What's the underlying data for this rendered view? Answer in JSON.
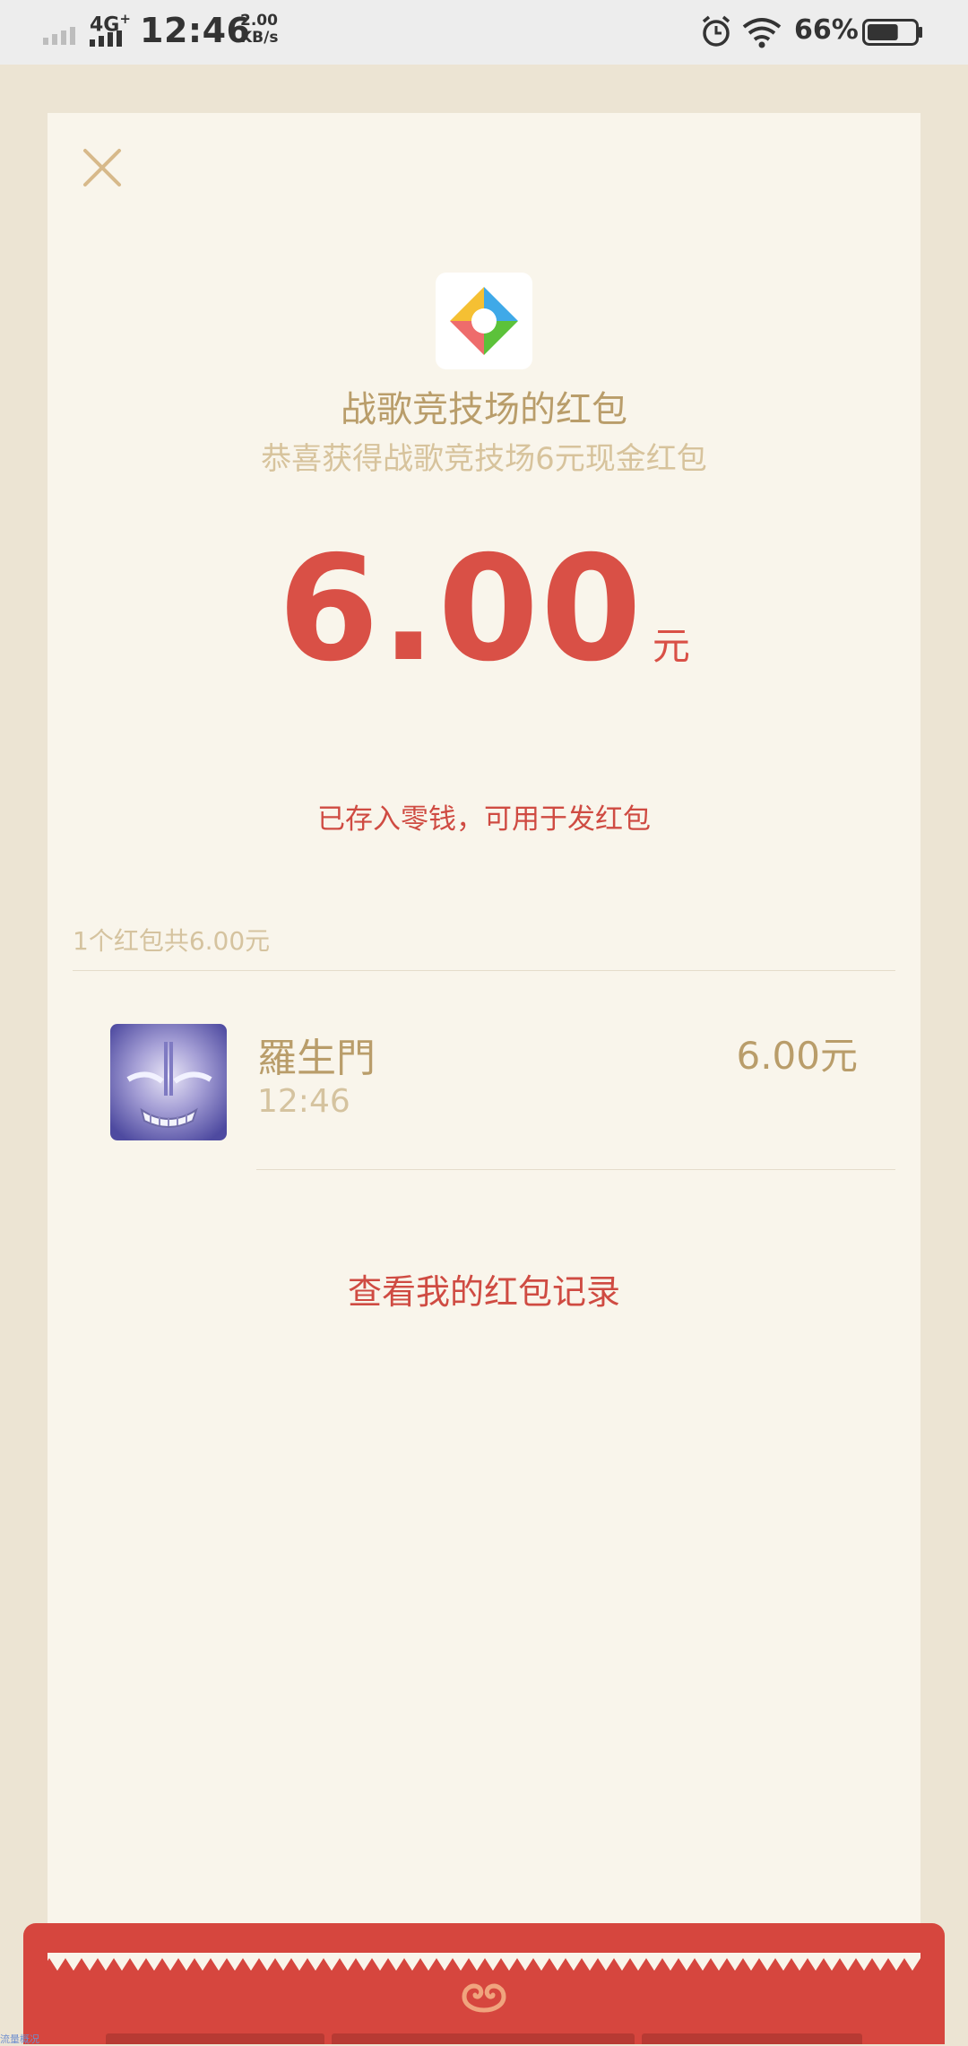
{
  "status_bar": {
    "network": "4G",
    "network_plus": "+",
    "time": "12:46",
    "speed_value": "2.00",
    "speed_unit": "KB/s",
    "battery_pct": "66%",
    "battery_level": 0.66,
    "icons": [
      "signal-icon",
      "alarm-icon",
      "wifi-icon",
      "battery-icon"
    ]
  },
  "card": {
    "close_icon": "close-icon",
    "app_logo": "game-arena-logo-icon",
    "title": "战歌竞技场的红包",
    "subtitle": "恭喜获得战歌竞技场6元现金红包",
    "amount": "6.00",
    "amount_unit": "元",
    "saved_note": "已存入零钱，可用于发红包",
    "summary": "1个红包共6.00元",
    "records": [
      {
        "name": "羅生門",
        "time": "12:46",
        "amount": "6.00元"
      }
    ],
    "history_link": "查看我的红包记录"
  },
  "footer": {
    "icon": "envelope-emblem-icon",
    "corner_text": "流量概况"
  },
  "colors": {
    "background": "#ece4d3",
    "card": "#f9f5eb",
    "gold": "#b99d6a",
    "light_gold": "#d5c39f",
    "red": "#d95046",
    "envelope_red": "#d6463e"
  }
}
